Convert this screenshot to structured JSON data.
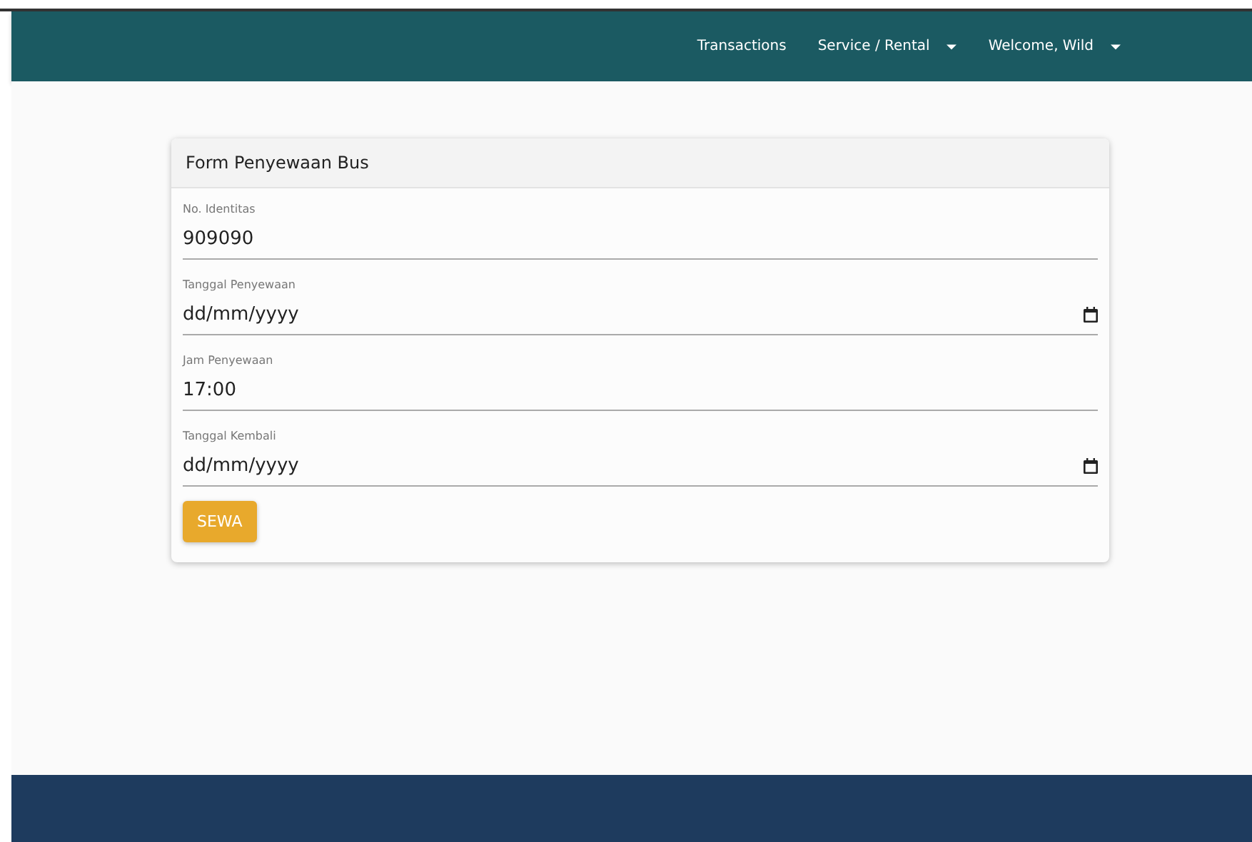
{
  "navbar": {
    "items": [
      {
        "label": "Transactions",
        "dropdown": false
      },
      {
        "label": "Service / Rental",
        "dropdown": true
      },
      {
        "label": "Welcome, Wild",
        "dropdown": true
      }
    ]
  },
  "form": {
    "title": "Form Penyewaan Bus",
    "fields": [
      {
        "label": "No. Identitas",
        "kind": "text",
        "value": "909090"
      },
      {
        "label": "Tanggal Penyewaan",
        "kind": "date",
        "value": "dd/mm/yyyy"
      },
      {
        "label": "Jam Penyewaan",
        "kind": "time",
        "value": "17:00"
      },
      {
        "label": "Tanggal Kembali",
        "kind": "date",
        "value": "dd/mm/yyyy"
      }
    ],
    "submit": "SEWA"
  }
}
